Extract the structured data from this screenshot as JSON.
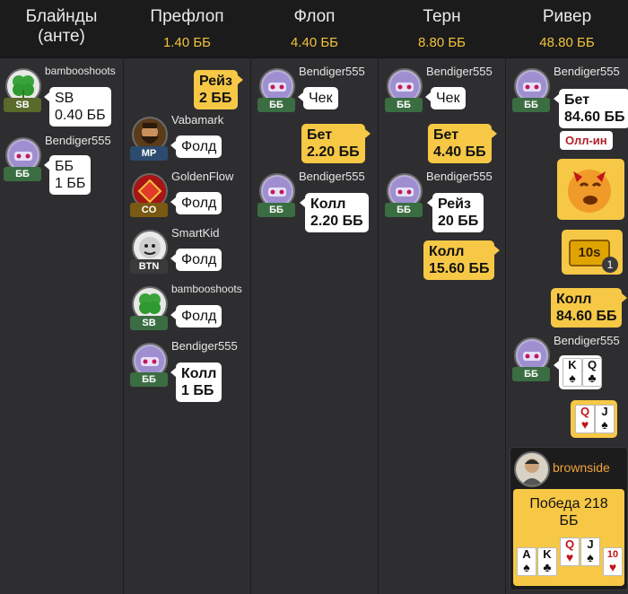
{
  "columns": [
    {
      "title": "Блайнды (анте)",
      "pot": ""
    },
    {
      "title": "Префлоп",
      "pot": "1.40 ББ"
    },
    {
      "title": "Флоп",
      "pot": "4.40 ББ"
    },
    {
      "title": "Терн",
      "pot": "8.80 ББ"
    },
    {
      "title": "Ривер",
      "pot": "48.80 ББ"
    }
  ],
  "blinds": [
    {
      "name": "bambooshoots",
      "pos": "SB",
      "line1": "SB",
      "line2": "0.40 ББ"
    },
    {
      "name": "Bendiger555",
      "pos": "ББ",
      "line1": "ББ",
      "line2": "1 ББ"
    }
  ],
  "preflop": {
    "raise": {
      "line1": "Рейз",
      "line2": "2 ББ"
    },
    "players": [
      {
        "name": "Vabamark",
        "pos": "MP",
        "action": "Фолд"
      },
      {
        "name": "GoldenFlow",
        "pos": "CO",
        "action": "Фолд"
      },
      {
        "name": "SmartKid",
        "pos": "BTN",
        "action": "Фолд"
      },
      {
        "name": "bambooshoots",
        "pos": "SB",
        "action": "Фолд"
      },
      {
        "name": "Bendiger555",
        "pos": "ББ",
        "line1": "Колл",
        "line2": "1 ББ"
      }
    ]
  },
  "flop": {
    "p1": {
      "name": "Bendiger555",
      "pos": "ББ",
      "action": "Чек"
    },
    "bet": {
      "line1": "Бет",
      "line2": "2.20 ББ"
    },
    "p2": {
      "name": "Bendiger555",
      "pos": "ББ",
      "line1": "Колл",
      "line2": "2.20 ББ"
    }
  },
  "turn": {
    "p1": {
      "name": "Bendiger555",
      "pos": "ББ",
      "action": "Чек"
    },
    "bet": {
      "line1": "Бет",
      "line2": "4.40 ББ"
    },
    "p2": {
      "name": "Bendiger555",
      "pos": "ББ",
      "line1": "Рейз",
      "line2": "20 ББ"
    },
    "call": {
      "line1": "Колл",
      "line2": "15.60 ББ"
    }
  },
  "river": {
    "p1": {
      "name": "Bendiger555",
      "pos": "ББ",
      "line1": "Бет",
      "line2": "84.60 ББ",
      "allin": "Олл-ин"
    },
    "timer": {
      "label": "10s",
      "count": "1"
    },
    "call": {
      "line1": "Колл",
      "line2": "84.60 ББ"
    },
    "p2": {
      "name": "Bendiger555",
      "pos": "ББ",
      "cards": [
        {
          "rank": "K",
          "suit": "♠"
        },
        {
          "rank": "Q",
          "suit": "♣"
        }
      ]
    },
    "opp_cards": [
      {
        "rank": "Q",
        "suit": "♥"
      },
      {
        "rank": "J",
        "suit": "♠"
      }
    ],
    "winner": {
      "name": "brownside",
      "line1": "Победа 218",
      "line2": "ББ"
    },
    "board": [
      {
        "rank": "A",
        "suit": "♠"
      },
      {
        "rank": "K",
        "suit": "♣"
      },
      {
        "rank": "Q",
        "suit": "♥"
      },
      {
        "rank": "J",
        "suit": "♠"
      },
      {
        "rank": "10",
        "suit": "♥"
      }
    ]
  },
  "colors": {
    "accent": "#f6c846",
    "pot": "#f2c23a",
    "allin": "#b2202a"
  }
}
